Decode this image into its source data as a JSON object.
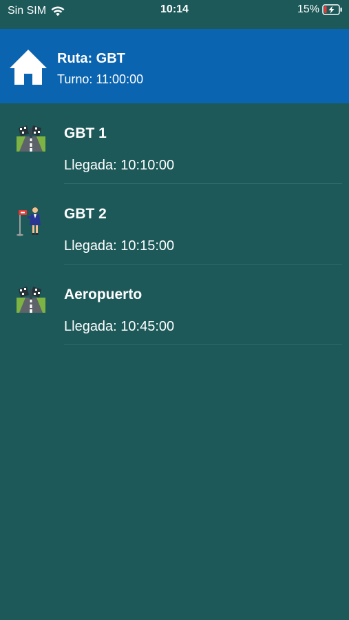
{
  "status_bar": {
    "carrier": "Sin SIM",
    "time": "10:14",
    "battery": "15%"
  },
  "header": {
    "title": "Ruta: GBT",
    "subtitle": "Turno: 11:00:00",
    "icon": "home-icon",
    "background": "#0a64b0"
  },
  "stops": [
    {
      "name": "GBT 1",
      "arrival": "Llegada: 10:10:00",
      "icon": "road-icon"
    },
    {
      "name": "GBT 2",
      "arrival": "Llegada: 10:15:00",
      "icon": "bus-stop-person-icon"
    },
    {
      "name": "Aeropuerto",
      "arrival": "Llegada: 10:45:00",
      "icon": "road-icon"
    }
  ],
  "colors": {
    "background": "#1d5959",
    "header": "#0a64b0",
    "text": "#ffffff"
  }
}
